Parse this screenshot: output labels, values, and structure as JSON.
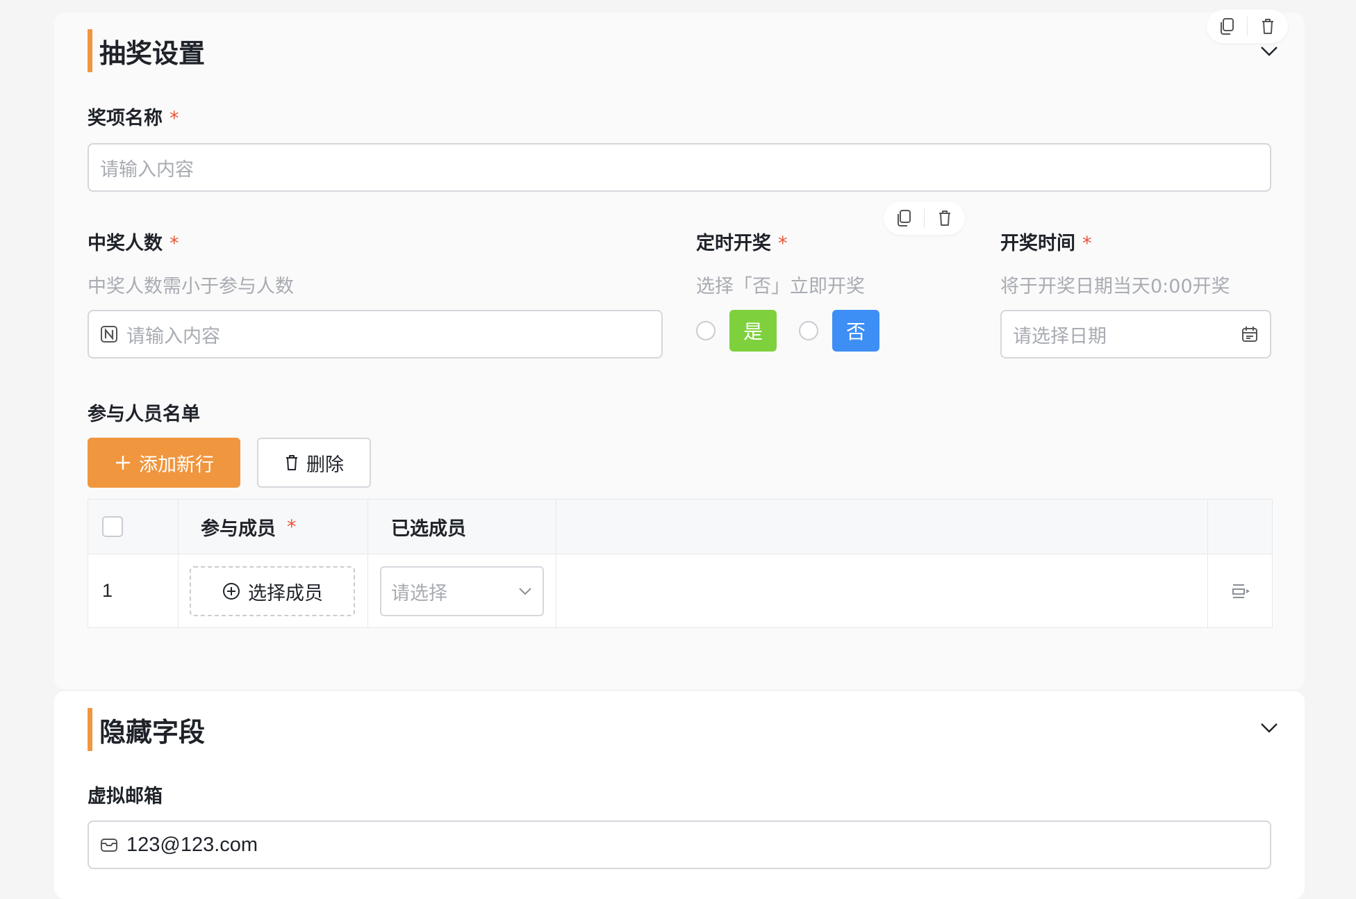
{
  "section1": {
    "title": "抽奖设置",
    "prize_name": {
      "label": "奖项名称",
      "placeholder": "请输入内容"
    },
    "winners": {
      "label": "中奖人数",
      "hint": "中奖人数需小于参与人数",
      "placeholder": "请输入内容"
    },
    "scheduled": {
      "label": "定时开奖",
      "hint": "选择「否」立即开奖",
      "options": [
        "是",
        "否"
      ]
    },
    "draw_time": {
      "label": "开奖时间",
      "hint": "将于开奖日期当天0:00开奖",
      "placeholder": "请选择日期"
    },
    "participants": {
      "label": "参与人员名单",
      "add_button": "添加新行",
      "delete_button": "删除",
      "columns": [
        "参与成员",
        "已选成员"
      ],
      "rows": [
        {
          "index": "1",
          "select_member": "选择成员",
          "selected_placeholder": "请选择"
        }
      ]
    }
  },
  "section2": {
    "title": "隐藏字段",
    "email": {
      "label": "虚拟邮箱",
      "value": "123@123.com"
    }
  },
  "required_mark": "*",
  "colors": {
    "accent": "#f0963e",
    "yes_tag": "#7ed13d",
    "no_tag": "#3d8ef5",
    "required": "#e8553b"
  },
  "icons": [
    "copy-icon",
    "trash-icon",
    "chevron-down-icon",
    "number-icon",
    "calendar-icon",
    "plus-icon",
    "plus-circle-icon",
    "row-action-icon",
    "mail-icon"
  ]
}
